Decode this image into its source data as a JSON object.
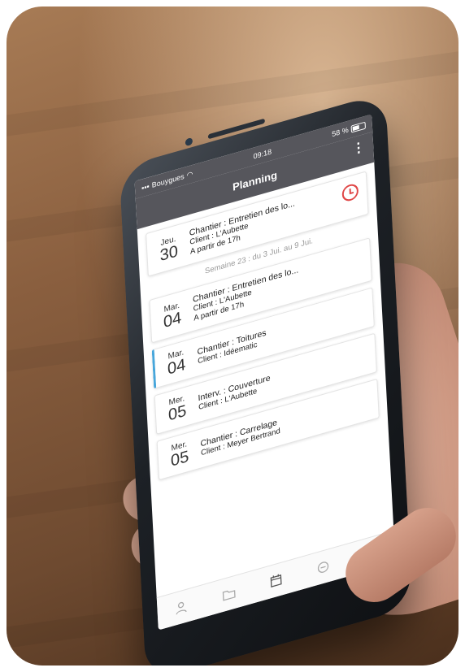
{
  "statusbar": {
    "carrier": "Bouygues",
    "time": "09:18",
    "battery": "58 %"
  },
  "header": {
    "title": "Planning",
    "menu_icon": "more-vertical-icon"
  },
  "planning": {
    "top_card": {
      "day": "Jeu.",
      "num": "30",
      "title": "Chantier : Entretien des lo...",
      "client": "Client : L'Aubette",
      "note": "A partir de 17h",
      "icon": "clock-icon",
      "icon_color": "#e04848"
    },
    "week_label": "Semaine 23 : du 3 Jui. au 9 Jui.",
    "cards": [
      {
        "day": "Mar.",
        "num": "04",
        "title": "Chantier : Entretien des lo...",
        "client": "Client : L'Aubette",
        "note": "A partir de 17h"
      },
      {
        "day": "Mar.",
        "num": "04",
        "title": "Chantier : Toitures",
        "client": "Client : Idéematic",
        "note": ""
      },
      {
        "day": "Mer.",
        "num": "05",
        "title": "Interv. : Couverture",
        "client": "Client : L'Aubette",
        "note": ""
      },
      {
        "day": "Mer.",
        "num": "05",
        "title": "Chantier : Carrelage",
        "client": "Client : Meyer Bertrand",
        "note": ""
      }
    ]
  },
  "tabbar": {
    "items": [
      {
        "icon": "user-icon"
      },
      {
        "icon": "folder-icon"
      },
      {
        "icon": "calendar-icon",
        "active": true
      },
      {
        "icon": "chat-icon"
      },
      {
        "icon": "document-icon"
      }
    ]
  },
  "colors": {
    "header_bg": "#56565c",
    "accent_blue": "#47a6db",
    "alert_red": "#e04848"
  }
}
